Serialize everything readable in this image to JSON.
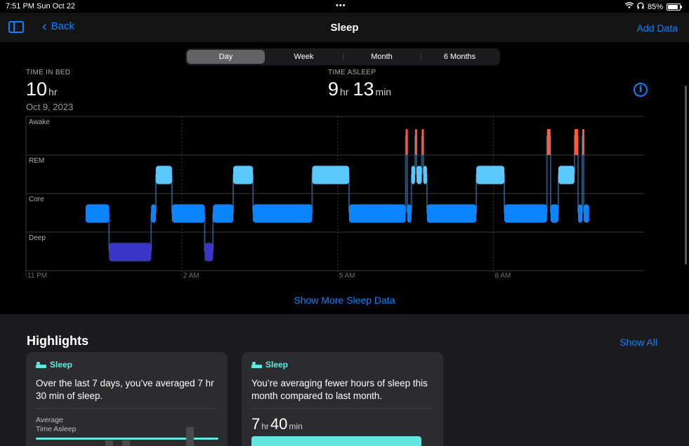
{
  "status": {
    "time": "7:51 PM",
    "date": "Sun Oct 22",
    "battery": "85%"
  },
  "nav": {
    "back_label": "Back",
    "title": "Sleep",
    "add_data": "Add Data"
  },
  "segments": [
    "Day",
    "Week",
    "Month",
    "6 Months"
  ],
  "segment_selected": "Day",
  "time_in_bed": {
    "label": "TIME IN BED",
    "value": "10",
    "unit": "hr",
    "date": "Oct 9, 2023"
  },
  "time_asleep": {
    "label": "TIME ASLEEP",
    "hours": "9",
    "hours_unit": "hr",
    "minutes": "13",
    "minutes_unit": "min"
  },
  "show_more": "Show More Sleep Data",
  "colors": {
    "awake": "#ff5a3c",
    "rem": "#5ac8fa",
    "core": "#0a84ff",
    "deep": "#3a35c4",
    "accent": "#0a84ff",
    "teal": "#63e6e2"
  },
  "chart_data": {
    "type": "timeline",
    "stages": [
      "Awake",
      "REM",
      "Core",
      "Deep"
    ],
    "x_ticks": [
      "11 PM",
      "2 AM",
      "5 AM",
      "8 AM"
    ],
    "x_tick_hours": [
      0,
      3,
      6,
      9
    ],
    "x_range_hours": [
      0,
      11.9
    ],
    "segments": [
      {
        "stage": "Core",
        "start": 1.15,
        "end": 1.6
      },
      {
        "stage": "Deep",
        "start": 1.6,
        "end": 2.41
      },
      {
        "stage": "Core",
        "start": 2.41,
        "end": 2.5
      },
      {
        "stage": "REM",
        "start": 2.5,
        "end": 2.81
      },
      {
        "stage": "Core",
        "start": 2.81,
        "end": 3.44
      },
      {
        "stage": "Deep",
        "start": 3.44,
        "end": 3.6
      },
      {
        "stage": "Core",
        "start": 3.6,
        "end": 3.99
      },
      {
        "stage": "REM",
        "start": 3.99,
        "end": 4.37
      },
      {
        "stage": "Core",
        "start": 4.37,
        "end": 5.51
      },
      {
        "stage": "REM",
        "start": 5.51,
        "end": 6.22
      },
      {
        "stage": "Core",
        "start": 6.22,
        "end": 7.31
      },
      {
        "stage": "Awake",
        "start": 7.31,
        "end": 7.34
      },
      {
        "stage": "Core",
        "start": 7.34,
        "end": 7.42
      },
      {
        "stage": "REM",
        "start": 7.42,
        "end": 7.49
      },
      {
        "stage": "Awake",
        "start": 7.49,
        "end": 7.52
      },
      {
        "stage": "REM",
        "start": 7.52,
        "end": 7.62
      },
      {
        "stage": "Awake",
        "start": 7.62,
        "end": 7.65
      },
      {
        "stage": "REM",
        "start": 7.65,
        "end": 7.72
      },
      {
        "stage": "Core",
        "start": 7.72,
        "end": 8.67
      },
      {
        "stage": "REM",
        "start": 8.67,
        "end": 9.21
      },
      {
        "stage": "Core",
        "start": 9.21,
        "end": 10.03
      },
      {
        "stage": "Awake",
        "start": 10.03,
        "end": 10.1
      },
      {
        "stage": "Core",
        "start": 10.1,
        "end": 10.25
      },
      {
        "stage": "REM",
        "start": 10.25,
        "end": 10.56
      },
      {
        "stage": "Awake",
        "start": 10.56,
        "end": 10.63
      },
      {
        "stage": "Core",
        "start": 10.63,
        "end": 10.71
      },
      {
        "stage": "Awake",
        "start": 10.71,
        "end": 10.74
      },
      {
        "stage": "Core",
        "start": 10.74,
        "end": 10.84
      }
    ]
  },
  "highlights": {
    "title": "Highlights",
    "show_all": "Show All",
    "cards": [
      {
        "category": "Sleep",
        "message": "Over the last 7 days, you’ve averaged 7 hr 30 min of sleep.",
        "avg_label_1": "Average",
        "avg_label_2": "Time Asleep"
      },
      {
        "category": "Sleep",
        "message": "You’re averaging fewer hours of sleep this month compared to last month.",
        "hours": "7",
        "hours_unit": "hr",
        "minutes": "40",
        "minutes_unit": "min"
      }
    ]
  }
}
